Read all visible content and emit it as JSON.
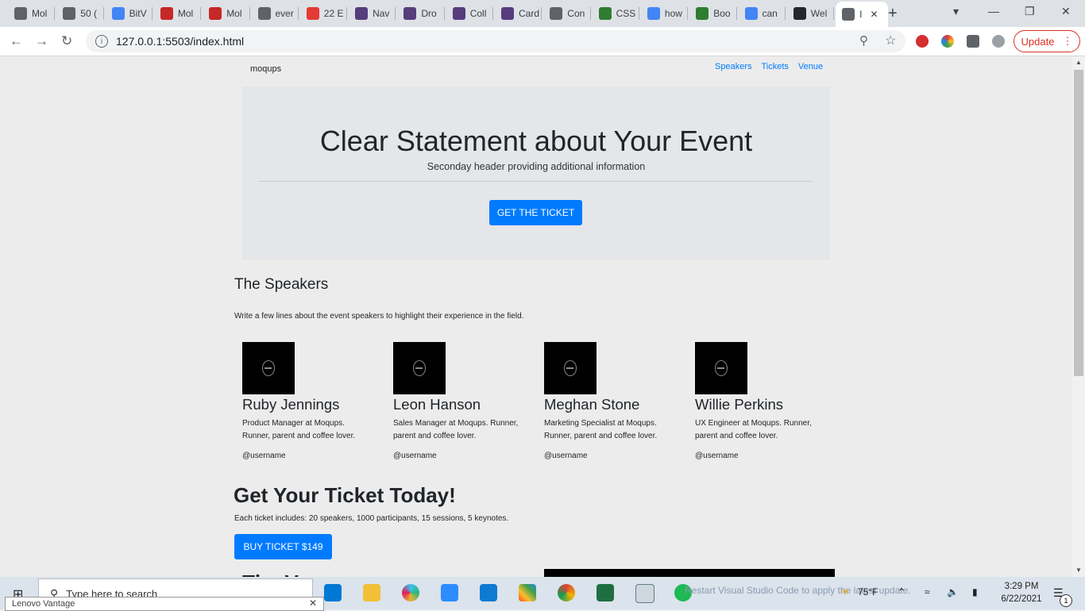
{
  "browser": {
    "tabs": [
      {
        "label": "Mol",
        "color": "#5f6368"
      },
      {
        "label": "50 (",
        "color": "#5f6368"
      },
      {
        "label": "BitV",
        "color": "#4285f4"
      },
      {
        "label": "Mol",
        "color": "#c62828"
      },
      {
        "label": "Mol",
        "color": "#c62828"
      },
      {
        "label": "ever",
        "color": "#5f6368"
      },
      {
        "label": "22 E",
        "color": "#e53935"
      },
      {
        "label": "Nav",
        "color": "#563d7c"
      },
      {
        "label": "Dro",
        "color": "#563d7c"
      },
      {
        "label": "Coll",
        "color": "#563d7c"
      },
      {
        "label": "Card",
        "color": "#563d7c"
      },
      {
        "label": "Con",
        "color": "#5f6368"
      },
      {
        "label": "CSS",
        "color": "#2e7d32"
      },
      {
        "label": "how",
        "color": "#4285f4"
      },
      {
        "label": "Boo",
        "color": "#2e7d32"
      },
      {
        "label": "can",
        "color": "#4285f4"
      },
      {
        "label": "Wel",
        "color": "#24292e"
      },
      {
        "label": "I",
        "color": "#5f6368"
      }
    ],
    "url": "127.0.0.1:5503/index.html",
    "update_label": "Update"
  },
  "site": {
    "brand": "moqups",
    "nav": [
      "Speakers",
      "Tickets",
      "Venue"
    ],
    "hero": {
      "title": "Clear Statement about Your Event",
      "subtitle": "Seconday header providing additional information",
      "cta": "GET THE TICKET"
    },
    "speakers": {
      "title": "The Speakers",
      "desc": "Write a few lines about the event speakers to highlight their experience in the field.",
      "cards": [
        {
          "name": "Ruby Jennings",
          "bio": "Product Manager at Moqups. Runner, parent and coffee lover.",
          "user": "@username"
        },
        {
          "name": "Leon Hanson",
          "bio": "Sales Manager at Moqups. Runner, parent and coffee lover.",
          "user": "@username"
        },
        {
          "name": "Meghan Stone",
          "bio": "Marketing Specialist at Moqups. Runner, parent and coffee lover.",
          "user": "@username"
        },
        {
          "name": "Willie Perkins",
          "bio": "UX Engineer at Moqups. Runner, parent and coffee lover.",
          "user": "@username"
        }
      ]
    },
    "ticket": {
      "title": "Get Your Ticket Today!",
      "desc": "Each ticket includes: 20 speakers, 1000 participants, 15 sessions, 5 keynotes.",
      "button": "BUY TICKET $149"
    },
    "venue_peek": "The V"
  },
  "taskbar": {
    "search_placeholder": "Type here to search",
    "notification": "Restart Visual Studio Code to apply the latest update.",
    "weather": "75°F",
    "time": "3:29 PM",
    "date": "6/22/2021",
    "toast": "Lenovo Vantage",
    "notif_count": "1"
  }
}
